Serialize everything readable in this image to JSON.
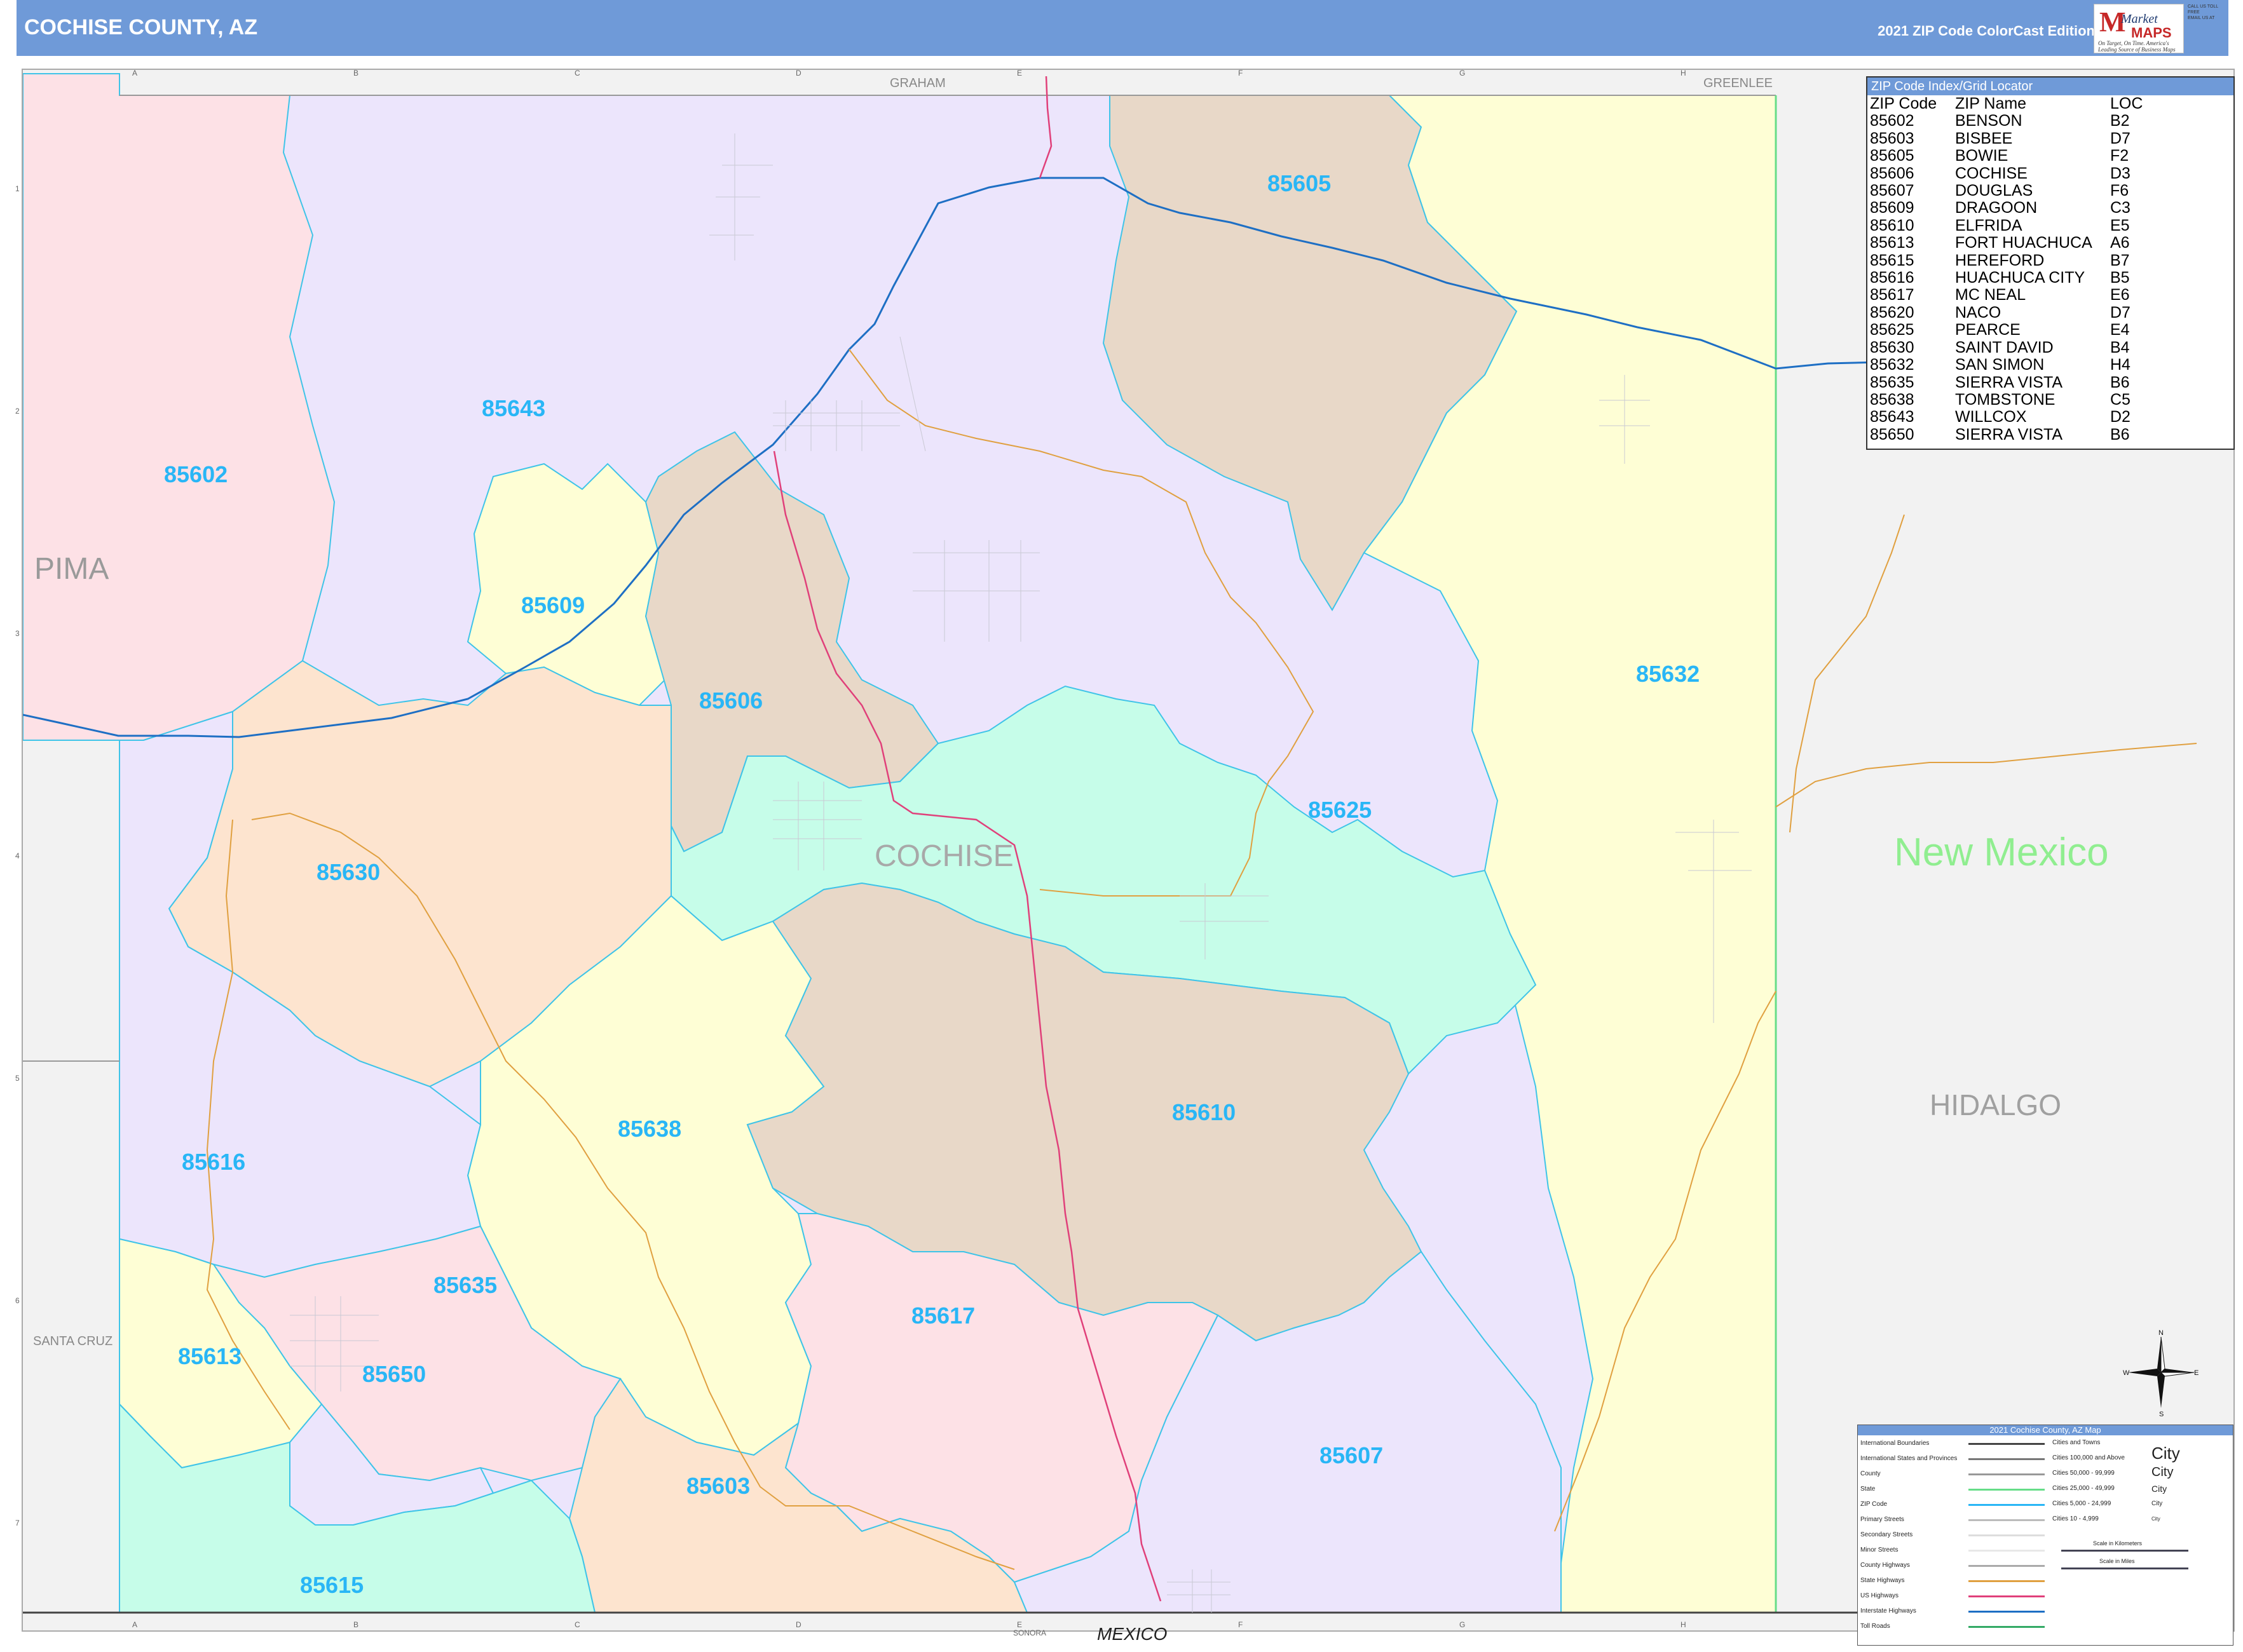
{
  "header": {
    "title": "COCHISE COUNTY, AZ",
    "edition": "2021 ZIP Code ColorCast Edition",
    "logo": {
      "brand_top": "Market",
      "brand_bottom": "MAPS",
      "tagline": "On Target, On Time. America's Leading Source of Business Maps"
    },
    "contact": {
      "call": "CALL US TOLL FREE",
      "email": "EMAIL US AT"
    }
  },
  "grid": {
    "columns": [
      "A",
      "B",
      "C",
      "D",
      "E",
      "F",
      "G",
      "H"
    ],
    "rows": [
      "1",
      "2",
      "3",
      "4",
      "5",
      "6",
      "7"
    ]
  },
  "region_labels": {
    "graham": "GRAHAM",
    "greenlee": "GREENLEE",
    "pima": "PIMA",
    "santa_cruz": "SANTA CRUZ",
    "cochise": "COCHISE",
    "new_mexico": "New Mexico",
    "hidalgo": "HIDALGO",
    "sonora": "SONORA",
    "mexico": "MEXICO"
  },
  "zips": [
    {
      "zip": "85602",
      "color": "#fde1e6"
    },
    {
      "zip": "85643",
      "color": "#ece5fc"
    },
    {
      "zip": "85605",
      "color": "#e8d8c8"
    },
    {
      "zip": "85632",
      "color": "#fefed5"
    },
    {
      "zip": "85609",
      "color": "#fefed5"
    },
    {
      "zip": "85606",
      "color": "#e8d8c8"
    },
    {
      "zip": "85630",
      "color": "#fde4cf"
    },
    {
      "zip": "85625",
      "color": "#c6fde9"
    },
    {
      "zip": "85616",
      "color": "#ece5fc"
    },
    {
      "zip": "85638",
      "color": "#fefed5"
    },
    {
      "zip": "85610",
      "color": "#e8d8c8"
    },
    {
      "zip": "85635",
      "color": "#fde1e6"
    },
    {
      "zip": "85617",
      "color": "#fde1e6"
    },
    {
      "zip": "85613",
      "color": "#fefed5"
    },
    {
      "zip": "85650",
      "color": "#ece5fc"
    },
    {
      "zip": "85607",
      "color": "#ece5fc"
    },
    {
      "zip": "85603",
      "color": "#fde4cf"
    },
    {
      "zip": "85615",
      "color": "#c6fde9"
    }
  ],
  "zip_label_color": "#29b6f6",
  "zip_index": {
    "title": "ZIP Code Index/Grid Locator",
    "headers": [
      "ZIP Code",
      "ZIP Name",
      "LOC"
    ],
    "rows": [
      [
        "85602",
        "BENSON",
        "B2"
      ],
      [
        "85603",
        "BISBEE",
        "D7"
      ],
      [
        "85605",
        "BOWIE",
        "F2"
      ],
      [
        "85606",
        "COCHISE",
        "D3"
      ],
      [
        "85607",
        "DOUGLAS",
        "F6"
      ],
      [
        "85609",
        "DRAGOON",
        "C3"
      ],
      [
        "85610",
        "ELFRIDA",
        "E5"
      ],
      [
        "85613",
        "FORT HUACHUCA",
        "A6"
      ],
      [
        "85615",
        "HEREFORD",
        "B7"
      ],
      [
        "85616",
        "HUACHUCA CITY",
        "B5"
      ],
      [
        "85617",
        "MC NEAL",
        "E6"
      ],
      [
        "85620",
        "NACO",
        "D7"
      ],
      [
        "85625",
        "PEARCE",
        "E4"
      ],
      [
        "85630",
        "SAINT DAVID",
        "B4"
      ],
      [
        "85632",
        "SAN SIMON",
        "H4"
      ],
      [
        "85635",
        "SIERRA VISTA",
        "B6"
      ],
      [
        "85638",
        "TOMBSTONE",
        "C5"
      ],
      [
        "85643",
        "WILLCOX",
        "D2"
      ],
      [
        "85650",
        "SIERRA VISTA",
        "B6"
      ]
    ]
  },
  "legend": {
    "title": "2021 Cochise County, AZ Map",
    "items": [
      {
        "label": "International Boundaries",
        "color": "#444444"
      },
      {
        "label": "International States and Provinces",
        "color": "#777777"
      },
      {
        "label": "County",
        "color": "#999999"
      },
      {
        "label": "State",
        "color": "#66dd88"
      },
      {
        "label": "ZIP Code",
        "color": "#29b6f6"
      },
      {
        "label": "Primary Streets",
        "color": "#bbbbbb"
      },
      {
        "label": "Secondary Streets",
        "color": "#dddddd"
      },
      {
        "label": "Minor Streets",
        "color": "#e8e8e8"
      },
      {
        "label": "County Highways",
        "color": "#aaaaaa"
      },
      {
        "label": "State Highways",
        "color": "#e0a040"
      },
      {
        "label": "US Highways",
        "color": "#e0407a"
      },
      {
        "label": "Interstate Highways",
        "color": "#1e6fc4"
      },
      {
        "label": "Toll Roads",
        "color": "#33aa66"
      }
    ],
    "cities_heading": "Cities and Towns",
    "cities": [
      {
        "range": "Cities 100,000 and Above",
        "sample": "City"
      },
      {
        "range": "Cities 50,000 - 99,999",
        "sample": "City"
      },
      {
        "range": "Cities 25,000 - 49,999",
        "sample": "City"
      },
      {
        "range": "Cities 5,000 - 24,999",
        "sample": "City"
      },
      {
        "range": "Cities 10 - 4,999",
        "sample": "City"
      }
    ],
    "scale_km": "Scale in Kilometers",
    "scale_mi": "Scale in Miles"
  },
  "compass": {
    "n": "N",
    "s": "S",
    "e": "E",
    "w": "W"
  },
  "colors": {
    "interstate": "#1e6fc4",
    "us_highway": "#e0407a",
    "state_highway": "#e0a040",
    "zip_border": "#3fc4e8"
  }
}
